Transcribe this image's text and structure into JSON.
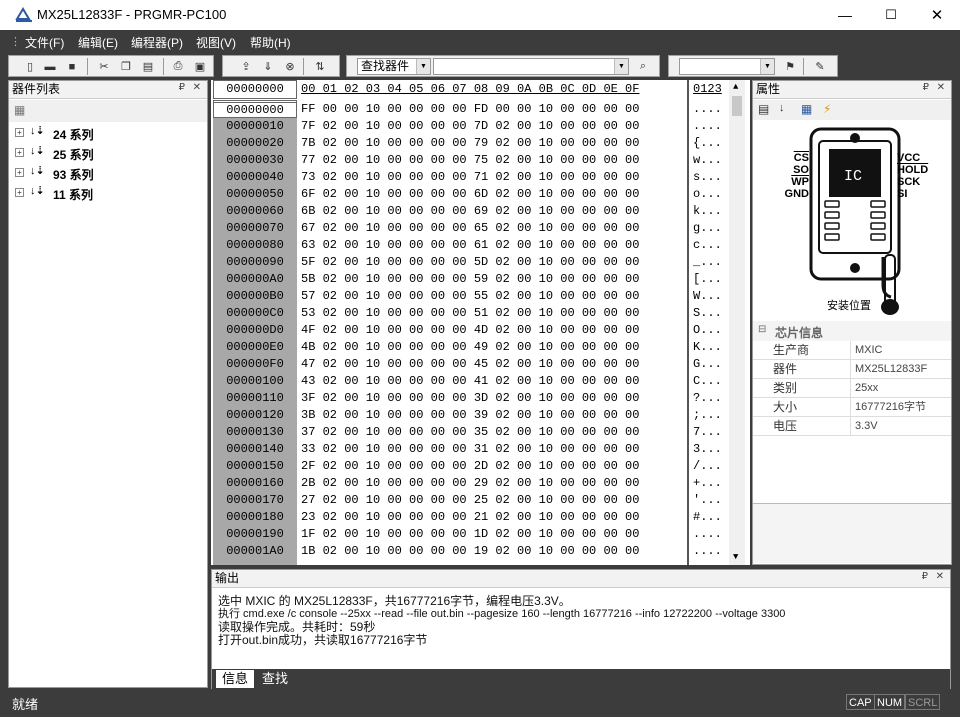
{
  "window": {
    "title": "MX25L12833F - PRGMR-PC100",
    "min": "—",
    "max": "☐",
    "close": "✕"
  },
  "menu": {
    "items": [
      "文件(F)",
      "编辑(E)",
      "编程器(P)",
      "视图(V)",
      "帮助(H)"
    ]
  },
  "toolbar": {
    "search_combo": "查找器件",
    "search_input": "",
    "combo2": ""
  },
  "device_list": {
    "title": "器件列表",
    "items": [
      {
        "label": "24 系列"
      },
      {
        "label": "25 系列"
      },
      {
        "label": "93 系列"
      },
      {
        "label": "11 系列"
      }
    ]
  },
  "hex": {
    "addr_input": "00000000",
    "header_addr": "00000000",
    "header_bytes": "00 01 02 03 04 05 06 07 08 09 0A 0B 0C 0D 0E 0F",
    "header_ascii": "0123",
    "rows": [
      {
        "addr": "00000000",
        "bytes": "FF 00 00 10 00 00 00 00 FD 00 00 10 00 00 00 00",
        "ascii": "...."
      },
      {
        "addr": "00000010",
        "bytes": "7F 02 00 10 00 00 00 00 7D 02 00 10 00 00 00 00",
        "ascii": "...."
      },
      {
        "addr": "00000020",
        "bytes": "7B 02 00 10 00 00 00 00 79 02 00 10 00 00 00 00",
        "ascii": "{..."
      },
      {
        "addr": "00000030",
        "bytes": "77 02 00 10 00 00 00 00 75 02 00 10 00 00 00 00",
        "ascii": "w..."
      },
      {
        "addr": "00000040",
        "bytes": "73 02 00 10 00 00 00 00 71 02 00 10 00 00 00 00",
        "ascii": "s..."
      },
      {
        "addr": "00000050",
        "bytes": "6F 02 00 10 00 00 00 00 6D 02 00 10 00 00 00 00",
        "ascii": "o..."
      },
      {
        "addr": "00000060",
        "bytes": "6B 02 00 10 00 00 00 00 69 02 00 10 00 00 00 00",
        "ascii": "k..."
      },
      {
        "addr": "00000070",
        "bytes": "67 02 00 10 00 00 00 00 65 02 00 10 00 00 00 00",
        "ascii": "g..."
      },
      {
        "addr": "00000080",
        "bytes": "63 02 00 10 00 00 00 00 61 02 00 10 00 00 00 00",
        "ascii": "c..."
      },
      {
        "addr": "00000090",
        "bytes": "5F 02 00 10 00 00 00 00 5D 02 00 10 00 00 00 00",
        "ascii": "_..."
      },
      {
        "addr": "000000A0",
        "bytes": "5B 02 00 10 00 00 00 00 59 02 00 10 00 00 00 00",
        "ascii": "[..."
      },
      {
        "addr": "000000B0",
        "bytes": "57 02 00 10 00 00 00 00 55 02 00 10 00 00 00 00",
        "ascii": "W..."
      },
      {
        "addr": "000000C0",
        "bytes": "53 02 00 10 00 00 00 00 51 02 00 10 00 00 00 00",
        "ascii": "S..."
      },
      {
        "addr": "000000D0",
        "bytes": "4F 02 00 10 00 00 00 00 4D 02 00 10 00 00 00 00",
        "ascii": "O..."
      },
      {
        "addr": "000000E0",
        "bytes": "4B 02 00 10 00 00 00 00 49 02 00 10 00 00 00 00",
        "ascii": "K..."
      },
      {
        "addr": "000000F0",
        "bytes": "47 02 00 10 00 00 00 00 45 02 00 10 00 00 00 00",
        "ascii": "G..."
      },
      {
        "addr": "00000100",
        "bytes": "43 02 00 10 00 00 00 00 41 02 00 10 00 00 00 00",
        "ascii": "C..."
      },
      {
        "addr": "00000110",
        "bytes": "3F 02 00 10 00 00 00 00 3D 02 00 10 00 00 00 00",
        "ascii": "?..."
      },
      {
        "addr": "00000120",
        "bytes": "3B 02 00 10 00 00 00 00 39 02 00 10 00 00 00 00",
        "ascii": ";..."
      },
      {
        "addr": "00000130",
        "bytes": "37 02 00 10 00 00 00 00 35 02 00 10 00 00 00 00",
        "ascii": "7..."
      },
      {
        "addr": "00000140",
        "bytes": "33 02 00 10 00 00 00 00 31 02 00 10 00 00 00 00",
        "ascii": "3..."
      },
      {
        "addr": "00000150",
        "bytes": "2F 02 00 10 00 00 00 00 2D 02 00 10 00 00 00 00",
        "ascii": "/..."
      },
      {
        "addr": "00000160",
        "bytes": "2B 02 00 10 00 00 00 00 29 02 00 10 00 00 00 00",
        "ascii": "+..."
      },
      {
        "addr": "00000170",
        "bytes": "27 02 00 10 00 00 00 00 25 02 00 10 00 00 00 00",
        "ascii": "'..."
      },
      {
        "addr": "00000180",
        "bytes": "23 02 00 10 00 00 00 00 21 02 00 10 00 00 00 00",
        "ascii": "#..."
      },
      {
        "addr": "00000190",
        "bytes": "1F 02 00 10 00 00 00 00 1D 02 00 10 00 00 00 00",
        "ascii": "...."
      },
      {
        "addr": "000001A0",
        "bytes": "1B 02 00 10 00 00 00 00 19 02 00 10 00 00 00 00",
        "ascii": "...."
      }
    ]
  },
  "properties": {
    "title": "属性",
    "chip": {
      "label": "IC",
      "left_pins": [
        "CS",
        "SO",
        "WP",
        "GND"
      ],
      "right_pins": [
        "VCC",
        "HOLD",
        "SCK",
        "SI"
      ],
      "caption": "安装位置"
    },
    "section": "芯片信息",
    "rows": [
      {
        "key": "生产商",
        "value": "MXIC"
      },
      {
        "key": "器件",
        "value": "MX25L12833F"
      },
      {
        "key": "类别",
        "value": "25xx"
      },
      {
        "key": "大小",
        "value": "16777216字节"
      },
      {
        "key": "电压",
        "value": "3.3V"
      }
    ]
  },
  "output": {
    "title": "输出",
    "lines": [
      "选中 MXIC 的 MX25L12833F，共16777216字节，编程电压3.3V。",
      "执行 cmd.exe /c console --25xx --read --file out.bin --pagesize 160 --length 16777216 --info 12722200 --voltage 3300",
      "读取操作完成。共耗时：59秒",
      "打开out.bin成功，共读取16777216字节"
    ],
    "tabs": [
      "信息",
      "查找"
    ]
  },
  "status": {
    "text": "就绪",
    "indicators": [
      "CAP",
      "NUM",
      "SCRL"
    ]
  }
}
